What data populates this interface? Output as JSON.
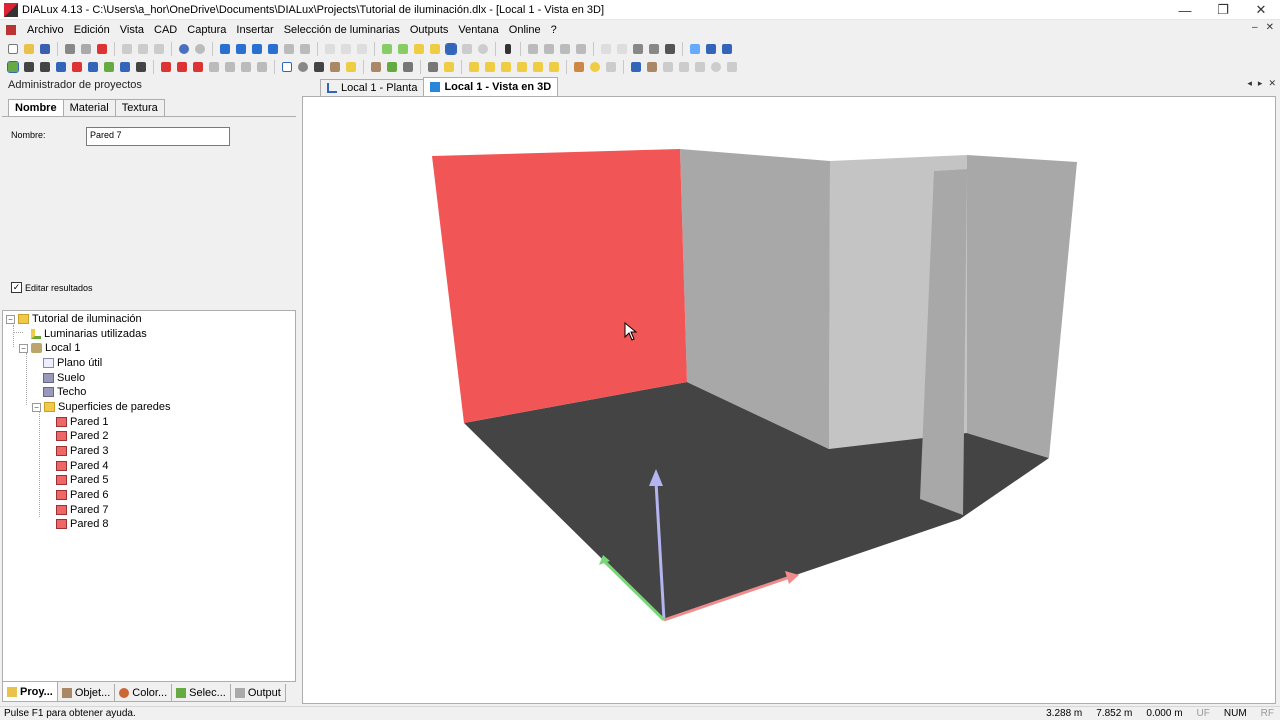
{
  "window": {
    "title": "DIALux 4.13 - C:\\Users\\a_hor\\OneDrive\\Documents\\DIALux\\Projects\\Tutorial de iluminación.dlx - [Local 1 - Vista en 3D]",
    "minimize": "—",
    "restore": "❐",
    "close": "✕"
  },
  "menu": {
    "items": [
      "Archivo",
      "Edición",
      "Vista",
      "CAD",
      "Captura",
      "Insertar",
      "Selección de luminarias",
      "Outputs",
      "Ventana",
      "Online",
      "?"
    ],
    "doc_minimize": "–",
    "doc_close": "✕"
  },
  "left_panel": {
    "header": "Administrador de proyectos",
    "tabs": [
      "Nombre",
      "Material",
      "Textura"
    ],
    "name_label": "Nombre:",
    "name_value": "Pared 7",
    "edit_results_label": "Editar resultados",
    "edit_results_checked": "✓"
  },
  "tree": {
    "root": "Tutorial de iluminación",
    "luminaires": "Luminarias utilizadas",
    "room": "Local 1",
    "workplane": "Plano útil",
    "floor": "Suelo",
    "ceiling": "Techo",
    "wall_surfaces": "Superficies de paredes",
    "walls": [
      "Pared 1",
      "Pared 2",
      "Pared 3",
      "Pared 4",
      "Pared 5",
      "Pared 6",
      "Pared 7",
      "Pared 8"
    ]
  },
  "bottom_tabs": [
    "Proy...",
    "Objet...",
    "Color...",
    "Selec...",
    "Output"
  ],
  "doc_tabs": [
    "Local 1 - Planta",
    "Local 1 - Vista en 3D"
  ],
  "doc_tab_controls": [
    "◂",
    "▸",
    "✕"
  ],
  "status": {
    "message": "Pulse F1 para obtener ayuda.",
    "x": "3.288 m",
    "y": "7.852 m",
    "z": "0.000 m",
    "uf": "UF",
    "num": "NUM",
    "rf": "RF"
  },
  "colors": {
    "selected_wall": "#f25555",
    "wall_light": "#c4c4c4",
    "wall_mid": "#a8a8a8",
    "floor": "#444444",
    "axis_z": "#b4b4f0",
    "axis_x": "#f08c8c",
    "axis_y": "#78d878"
  }
}
